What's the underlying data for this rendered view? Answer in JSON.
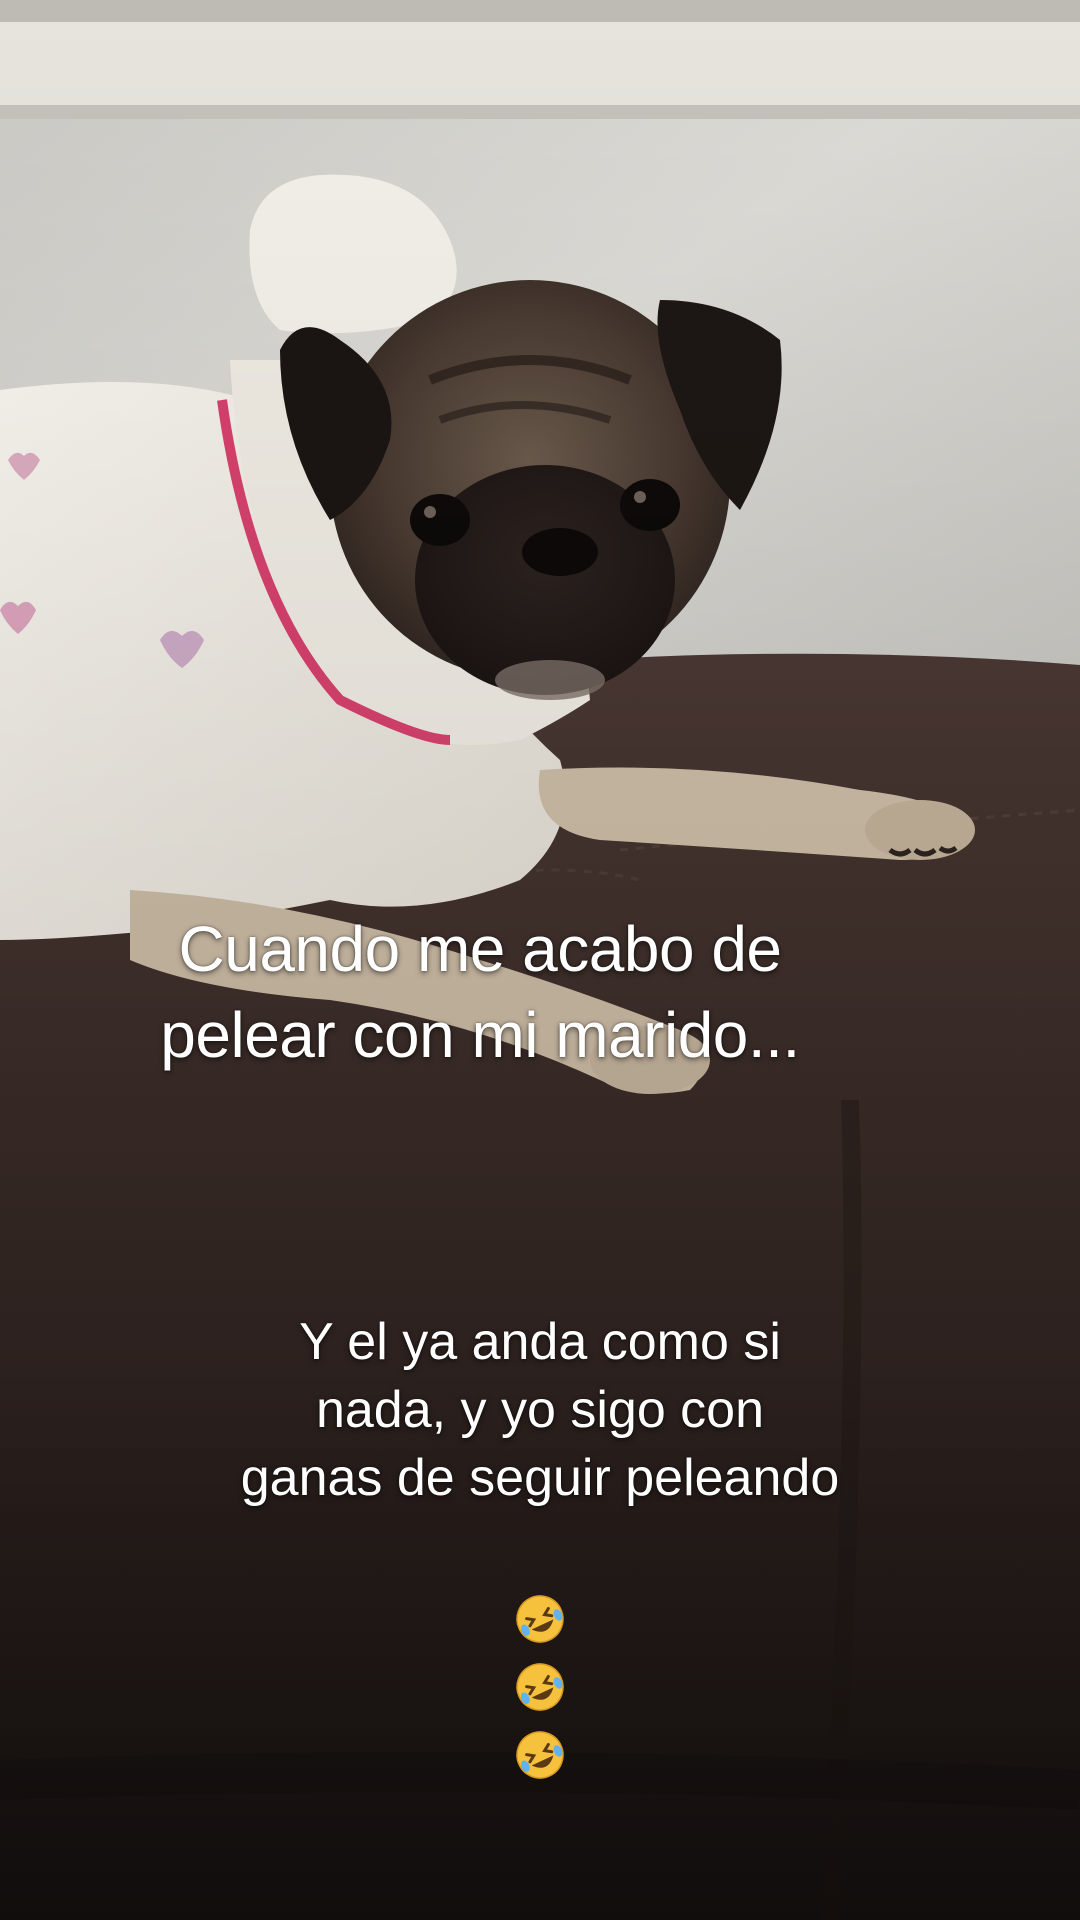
{
  "overlay": {
    "main_caption": "Cuando me acabo de\npelear con mi marido...",
    "secondary_caption": "Y el ya anda como si\nnada, y yo sigo con\nganas de seguir peleando",
    "emoji": [
      "rolling-on-floor-laughing",
      "rolling-on-floor-laughing",
      "rolling-on-floor-laughing"
    ]
  },
  "colors": {
    "wall": "#d9d8d3",
    "trim": "#e8e6df",
    "couch": "#3a2c28",
    "sweater": "#f4f1ea",
    "collar": "#d6416e",
    "text": "#ffffff"
  }
}
